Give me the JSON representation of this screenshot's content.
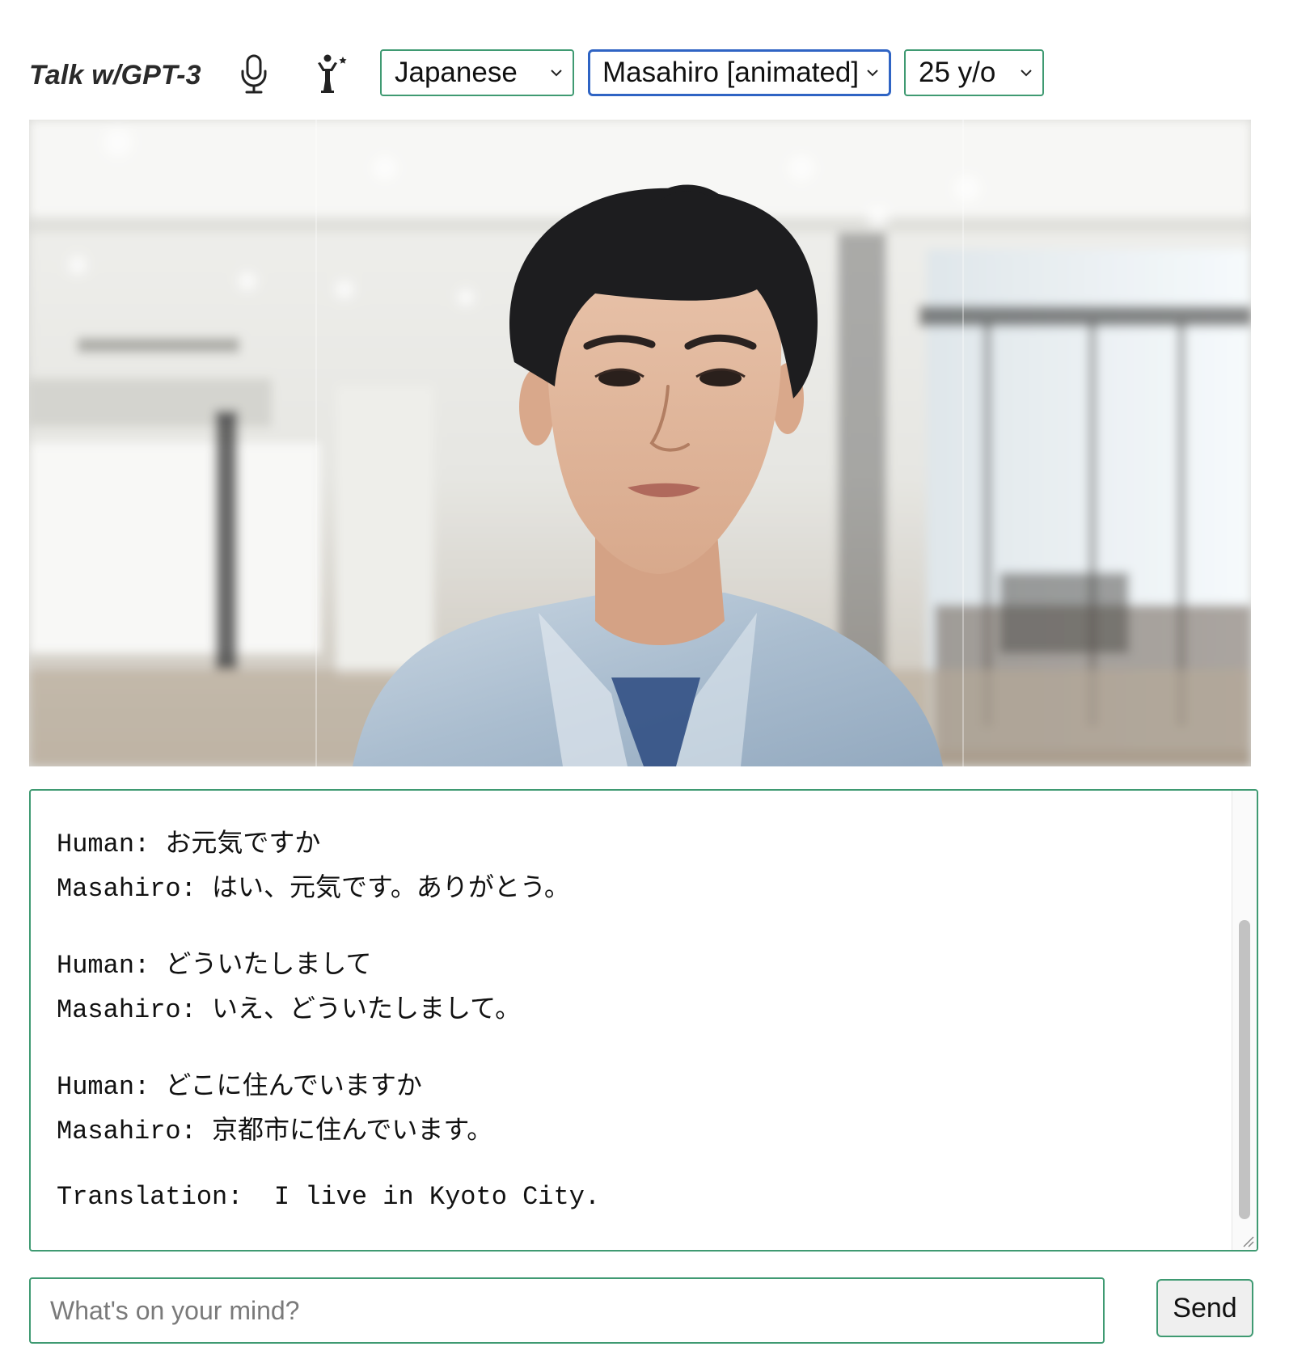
{
  "app": {
    "title": "Talk w/GPT-3"
  },
  "toolbar": {
    "mic_icon": "microphone-icon",
    "avatar_icon": "animated-person-icon",
    "language": {
      "selected": "Japanese"
    },
    "persona": {
      "selected": "Masahiro [animated]"
    },
    "age": {
      "selected": "25 y/o"
    }
  },
  "photo": {
    "subject": "avatar-photo"
  },
  "transcript": {
    "exchanges": [
      {
        "human_label": "Human:",
        "human_text": "お元気ですか",
        "ai_label": "Masahiro:",
        "ai_text": "はい、元気です。ありがとう。"
      },
      {
        "human_label": "Human:",
        "human_text": "どういたしまして",
        "ai_label": "Masahiro:",
        "ai_text": "いえ、どういたしまして。"
      },
      {
        "human_label": "Human:",
        "human_text": "どこに住んでいますか",
        "ai_label": "Masahiro:",
        "ai_text": "京都市に住んでいます。"
      }
    ],
    "translation_label": "Translation:",
    "translation_text": "I live in Kyoto City."
  },
  "composer": {
    "placeholder": "What's on your mind?",
    "value": "",
    "send_label": "Send"
  },
  "colors": {
    "accent_green": "#3f9a72",
    "focus_blue": "#2f64c4"
  }
}
